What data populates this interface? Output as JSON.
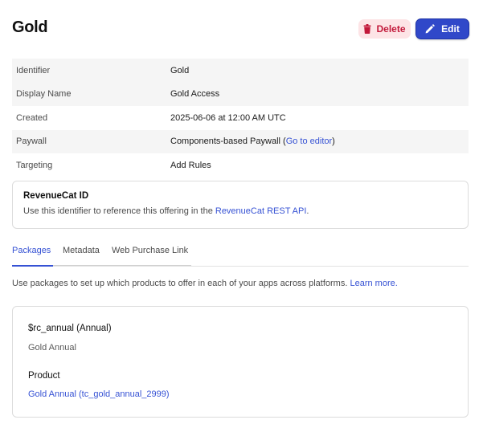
{
  "header": {
    "title": "Gold",
    "delete_label": "Delete",
    "edit_label": "Edit",
    "delete_color": "#c2183a",
    "edit_color": "#3048c9"
  },
  "details": {
    "rows": [
      {
        "label": "Identifier",
        "value": "Gold"
      },
      {
        "label": "Display Name",
        "value": "Gold Access"
      },
      {
        "label": "Created",
        "value": "2025-06-06 at 12:00 AM UTC"
      },
      {
        "label": "Paywall",
        "value_prefix": "Components-based Paywall (",
        "value_link": "Go to editor",
        "value_suffix": ")"
      },
      {
        "label": "Targeting",
        "value_link": "Add Rules"
      }
    ]
  },
  "revenuecat_id": {
    "title": "RevenueCat ID",
    "desc_prefix": "Use this identifier to reference this offering in the ",
    "desc_link": "RevenueCat REST API",
    "desc_suffix": "."
  },
  "tabs": [
    {
      "label": "Packages",
      "active": true
    },
    {
      "label": "Metadata",
      "active": false
    },
    {
      "label": "Web Purchase Link",
      "active": false
    }
  ],
  "help": {
    "text": "Use packages to set up which products to offer in each of your apps across platforms. ",
    "link": "Learn more."
  },
  "package": {
    "title": "$rc_annual (Annual)",
    "subtitle": "Gold Annual",
    "product_label": "Product",
    "product_link": "Gold Annual (tc_gold_annual_2999)"
  },
  "icons": {
    "delete": "trash-icon",
    "edit": "pencil-icon"
  },
  "colors": {
    "link": "#3652d4",
    "stripe": "#f5f5f5"
  }
}
